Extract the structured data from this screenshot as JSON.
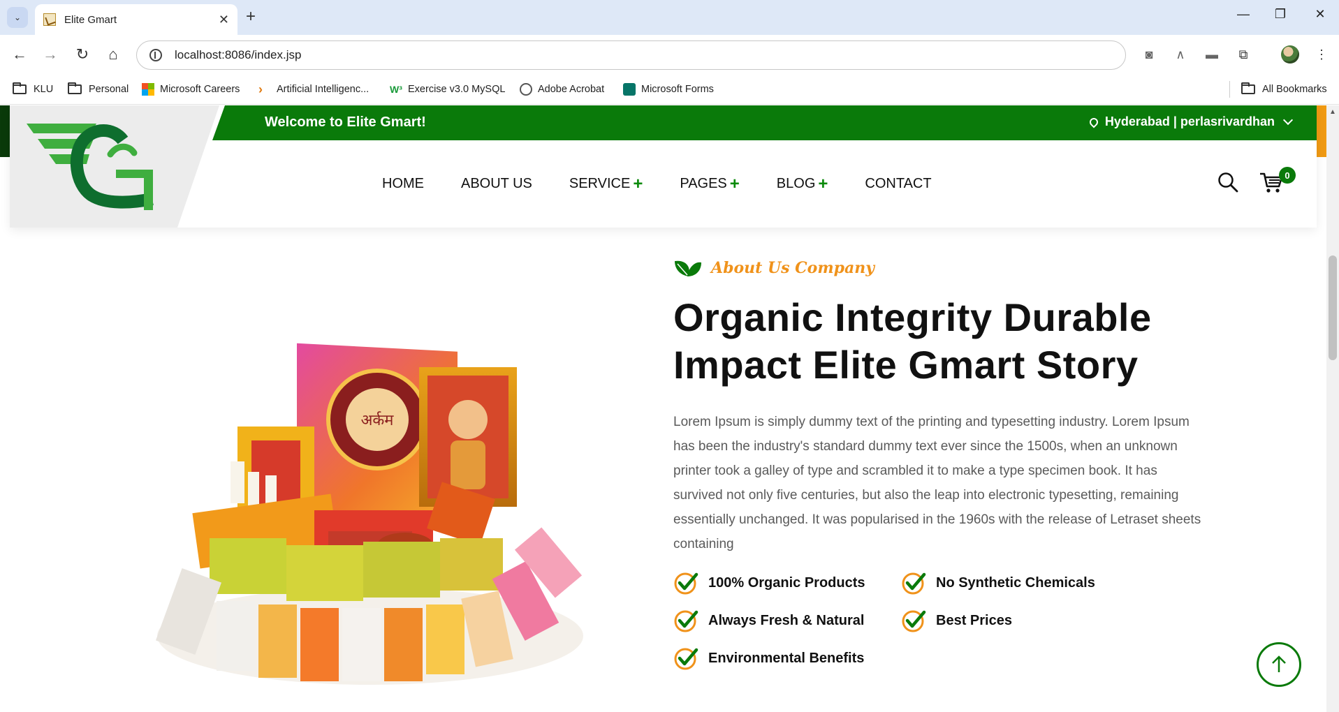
{
  "browser": {
    "tab_title": "Elite Gmart",
    "address": "localhost:8086/index.jsp",
    "bookmarks": [
      "KLU",
      "Personal",
      "Microsoft Careers",
      "Artificial Intelligenc...",
      "Exercise v3.0 MySQL",
      "Adobe Acrobat",
      "Microsoft Forms"
    ],
    "all_bookmarks": "All Bookmarks"
  },
  "topbar": {
    "welcome": "Welcome to Elite Gmart!",
    "location": "Hyderabad | perlasrivardhan"
  },
  "nav": {
    "items": [
      "HOME",
      "ABOUT US",
      "SERVICE",
      "PAGES",
      "BLOG",
      "CONTACT"
    ],
    "plus": "+"
  },
  "cart": {
    "count": "0"
  },
  "about": {
    "tagline": "About Us Company",
    "headline_line1": "Organic Integrity Durable",
    "headline_line2": "Impact Elite Gmart Story",
    "paragraph": "Lorem Ipsum is simply dummy text of the printing and typesetting industry. Lorem Ipsum has been the industry's standard dummy text ever since the 1500s, when an unknown printer took a galley of type and scrambled it to make a type specimen book. It has survived not only five centuries, but also the leap into electronic typesetting, remaining essentially unchanged. It was popularised in the 1960s with the release of Letraset sheets containing",
    "features": [
      "100% Organic Products",
      "No Synthetic Chemicals",
      "Always Fresh & Natural",
      "Best Prices",
      "Environmental Benefits"
    ]
  },
  "colors": {
    "brand_green": "#0a7a0a",
    "accent_orange": "#f0921a"
  }
}
